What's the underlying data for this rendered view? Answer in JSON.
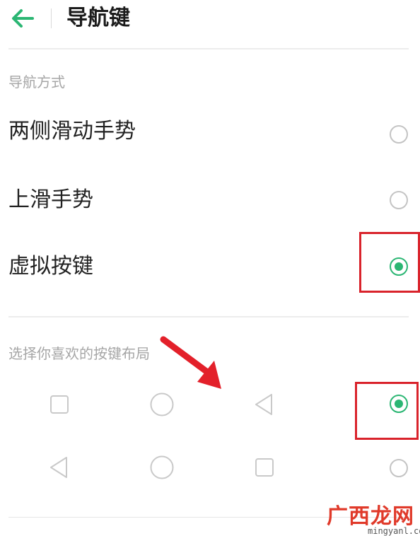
{
  "header": {
    "title": "导航键",
    "back_icon": "arrow-left-icon"
  },
  "section_nav": {
    "label": "导航方式",
    "options": [
      {
        "label": "两侧滑动手势",
        "selected": false
      },
      {
        "label": "上滑手势",
        "selected": false
      },
      {
        "label": "虚拟按键",
        "selected": true
      }
    ]
  },
  "section_layout": {
    "label": "选择你喜欢的按键布局",
    "layouts": [
      {
        "icons": [
          "square-icon",
          "circle-icon",
          "triangle-left-icon"
        ],
        "selected": true
      },
      {
        "icons": [
          "triangle-left-icon",
          "circle-icon",
          "square-icon"
        ],
        "selected": false
      }
    ]
  },
  "watermark": {
    "text": "广西龙网",
    "url": "mingyanl.com"
  },
  "colors": {
    "accent": "#2bb673",
    "highlight": "#d9232b",
    "arrow": "#e3202a"
  }
}
